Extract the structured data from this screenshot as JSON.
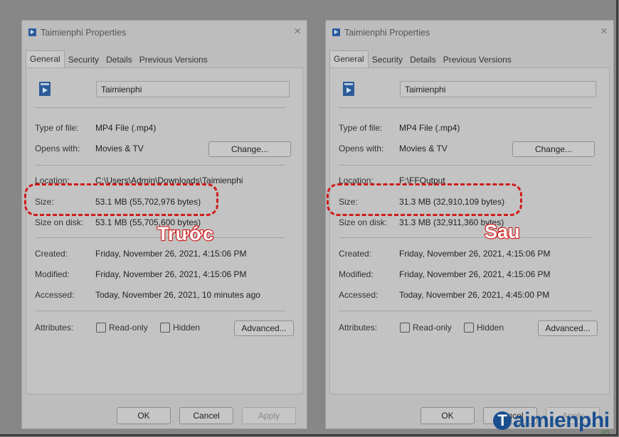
{
  "left": {
    "title": "Taimienphi Properties",
    "close": "×",
    "tabs": [
      "General",
      "Security",
      "Details",
      "Previous Versions"
    ],
    "file_name": "Taimienphi",
    "type_label": "Type of file:",
    "type_value": "MP4 File (.mp4)",
    "opens_label": "Opens with:",
    "opens_value": "Movies & TV",
    "change_button": "Change...",
    "location_label": "Location:",
    "location_value": "C:\\Users\\Admin\\Downloads\\Taimienphi",
    "size_label": "Size:",
    "size_value": "53.1 MB (55,702,976 bytes)",
    "disk_label": "Size on disk:",
    "disk_value": "53.1 MB (55,705,600 bytes)",
    "created_label": "Created:",
    "created_value": "Friday, November 26, 2021, 4:15:06 PM",
    "modified_label": "Modified:",
    "modified_value": "Friday, November 26, 2021, 4:15:06 PM",
    "accessed_label": "Accessed:",
    "accessed_value": "Today, November 26, 2021, 10 minutes ago",
    "attributes_label": "Attributes:",
    "readonly_label": "Read-only",
    "hidden_label": "Hidden",
    "advanced_button": "Advanced...",
    "ok_button": "OK",
    "cancel_button": "Cancel",
    "apply_button": "Apply",
    "annotation": "Trước"
  },
  "right": {
    "title": "Taimienphi Properties",
    "close": "×",
    "tabs": [
      "General",
      "Security",
      "Details",
      "Previous Versions"
    ],
    "file_name": "Taimienphi",
    "type_label": "Type of file:",
    "type_value": "MP4 File (.mp4)",
    "opens_label": "Opens with:",
    "opens_value": "Movies & TV",
    "change_button": "Change...",
    "location_label": "Location:",
    "location_value": "F:\\FFOutput",
    "size_label": "Size:",
    "size_value": "31.3 MB (32,910,109 bytes)",
    "disk_label": "Size on disk:",
    "disk_value": "31.3 MB (32,911,360 bytes)",
    "created_label": "Created:",
    "created_value": "Friday, November 26, 2021, 4:15:06 PM",
    "modified_label": "Modified:",
    "modified_value": "Friday, November 26, 2021, 4:15:06 PM",
    "accessed_label": "Accessed:",
    "accessed_value": "Today, November 26, 2021, 4:45:00 PM",
    "attributes_label": "Attributes:",
    "readonly_label": "Read-only",
    "hidden_label": "Hidden",
    "advanced_button": "Advanced...",
    "ok_button": "OK",
    "cancel_button": "Cancel",
    "apply_button": "Apply",
    "annotation": "Sau"
  },
  "watermark": {
    "first": "T",
    "rest": "aimienphi",
    "suffix": ".vn"
  },
  "colors": {
    "annotation": "#d11a1a",
    "watermark": "#1a4f8f"
  }
}
